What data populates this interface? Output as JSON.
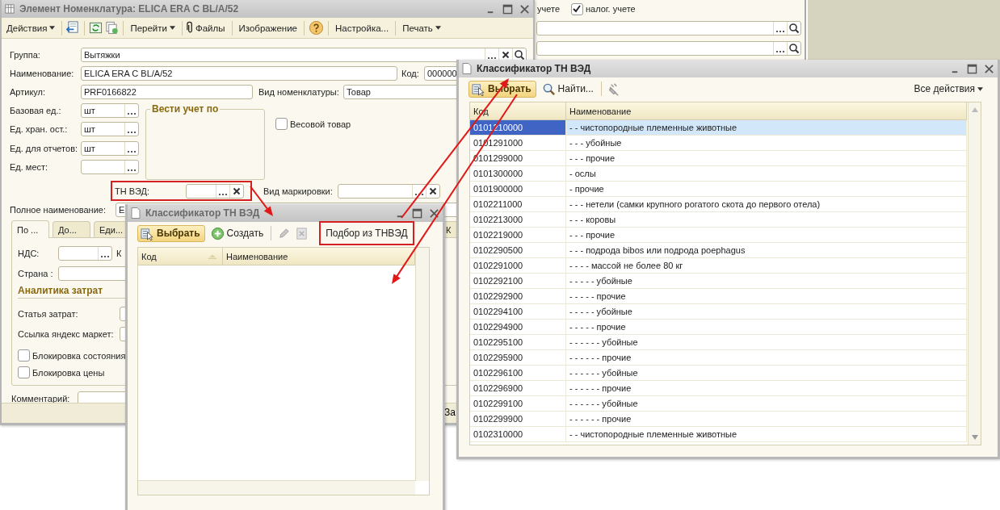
{
  "back_window": {
    "label": "учете",
    "checkbox": {
      "label": "налог. учете",
      "checked": true
    }
  },
  "main_window": {
    "title": "Элемент Номенклатура: ELICA ERA C BL/A/52",
    "active": false,
    "toolbar": [
      {
        "label": "Действия",
        "dropdown": true
      },
      {
        "label": "Перейти",
        "dropdown": true
      },
      {
        "label": "Файлы",
        "dropdown": false
      },
      {
        "label": "Изображение",
        "dropdown": false
      },
      {
        "label": "Настройка...",
        "dropdown": false
      },
      {
        "label": "Печать",
        "dropdown": true
      }
    ],
    "group": {
      "label": "Группа:",
      "value": "Вытяжки"
    },
    "name": {
      "label": "Наименование:",
      "value": "ELICA ERA C BL/A/52"
    },
    "code": {
      "label": "Код:",
      "value": "000000"
    },
    "article": {
      "label": "Артикул:",
      "value": "PRF0166822"
    },
    "item_type": {
      "label": "Вид номенклатуры:",
      "value": "Товар"
    },
    "units": [
      {
        "label": "Базовая ед.:",
        "value": "шт"
      },
      {
        "label": "Ед. хран. ост.:",
        "value": "шт"
      },
      {
        "label": "Ед. для отчетов:",
        "value": "шт"
      },
      {
        "label": "Ед. мест:"
      }
    ],
    "accounting_group": "Вести учет по",
    "weight_item": {
      "label": "Весовой товар",
      "checked": false
    },
    "tnved": {
      "label": "ТН ВЭД:"
    },
    "marking_type": {
      "label": "Вид маркировки:"
    },
    "full_name": {
      "label": "Полное наименование:",
      "value": "E"
    },
    "tabs": [
      {
        "label": "По ...",
        "selected": true
      },
      {
        "label": "До...",
        "selected": false
      },
      {
        "label": "Еди...",
        "selected": false
      },
      {
        "label": "К",
        "selected": false
      }
    ],
    "vat": {
      "label": "НДС:"
    },
    "vat_side_label": "К",
    "country": {
      "label": "Страна :"
    },
    "section": "Аналитика затрат",
    "cost_item": {
      "label": "Статья затрат:"
    },
    "market_link": {
      "label": "Ссылка яндекс маркет:"
    },
    "checkboxes": [
      {
        "label": "Блокировка состояния",
        "checked": false
      },
      {
        "label": "Блокировка цены",
        "checked": false
      }
    ],
    "comment": {
      "label": "Комментарий:"
    },
    "footer_button": "За"
  },
  "picker_dialog": {
    "title": "Классификатор ТН ВЭД",
    "active": false,
    "select": "Выбрать",
    "create": "Создать",
    "pick": "Подбор из ТНВЭД",
    "columns": [
      "Код",
      "Наименование"
    ]
  },
  "classifier_dialog": {
    "title": "Классификатор ТН ВЭД",
    "active": true,
    "select": "Выбрать",
    "find": "Найти...",
    "all_actions": "Все действия",
    "columns": [
      "Код",
      "Наименование"
    ],
    "rows": [
      {
        "code": "0101210000",
        "name": "- - чистопородные племенные животные",
        "selected": true
      },
      {
        "code": "0101291000",
        "name": "- - - убойные",
        "selected": false
      },
      {
        "code": "0101299000",
        "name": "- - - прочие",
        "selected": false
      },
      {
        "code": "0101300000",
        "name": "- ослы",
        "selected": false
      },
      {
        "code": "0101900000",
        "name": "- прочие",
        "selected": false
      },
      {
        "code": "0102211000",
        "name": "- - - нетели (самки крупного рогатого скота до первого отела)",
        "selected": false
      },
      {
        "code": "0102213000",
        "name": "- - - коровы",
        "selected": false
      },
      {
        "code": "0102219000",
        "name": "- - - прочие",
        "selected": false
      },
      {
        "code": "0102290500",
        "name": "- - - подрода bibos или подрода poephagus",
        "selected": false
      },
      {
        "code": "0102291000",
        "name": "- - - - массой не более 80 кг",
        "selected": false
      },
      {
        "code": "0102292100",
        "name": "- - - - - убойные",
        "selected": false
      },
      {
        "code": "0102292900",
        "name": "- - - - - прочие",
        "selected": false
      },
      {
        "code": "0102294100",
        "name": "- - - - - убойные",
        "selected": false
      },
      {
        "code": "0102294900",
        "name": "- - - - - прочие",
        "selected": false
      },
      {
        "code": "0102295100",
        "name": "- - - - - - убойные",
        "selected": false
      },
      {
        "code": "0102295900",
        "name": "- - - - - - прочие",
        "selected": false
      },
      {
        "code": "0102296100",
        "name": "- - - - - - убойные",
        "selected": false
      },
      {
        "code": "0102296900",
        "name": "- - - - - - прочие",
        "selected": false
      },
      {
        "code": "0102299100",
        "name": "- - - - - - убойные",
        "selected": false
      },
      {
        "code": "0102299900",
        "name": "- - - - - - прочие",
        "selected": false
      },
      {
        "code": "0102310000",
        "name": "- - чистопородные племенные животные",
        "selected": false
      }
    ]
  }
}
